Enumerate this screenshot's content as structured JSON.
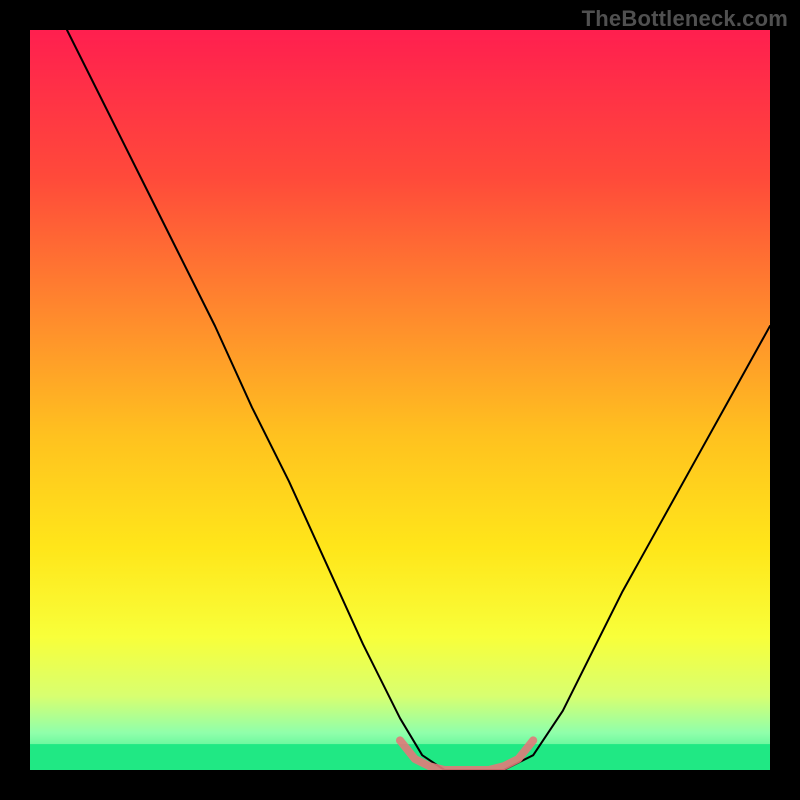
{
  "watermark": "TheBottleneck.com",
  "chart_data": {
    "type": "line",
    "title": "",
    "xlabel": "",
    "ylabel": "",
    "xlim": [
      0,
      100
    ],
    "ylim": [
      0,
      100
    ],
    "background_gradient_stops": [
      {
        "offset": 0.0,
        "color": "#ff1f4f"
      },
      {
        "offset": 0.2,
        "color": "#ff4a3a"
      },
      {
        "offset": 0.4,
        "color": "#ff8f2c"
      },
      {
        "offset": 0.55,
        "color": "#ffc21f"
      },
      {
        "offset": 0.7,
        "color": "#ffe61a"
      },
      {
        "offset": 0.82,
        "color": "#f8ff3a"
      },
      {
        "offset": 0.9,
        "color": "#d8ff70"
      },
      {
        "offset": 0.95,
        "color": "#8fffab"
      },
      {
        "offset": 1.0,
        "color": "#20e884"
      }
    ],
    "bottom_band": {
      "y_from": 96.5,
      "y_to": 100,
      "color": "#20e884"
    },
    "series": [
      {
        "name": "bottleneck-curve",
        "color": "#000000",
        "width": 2,
        "x": [
          5,
          10,
          15,
          20,
          25,
          30,
          35,
          40,
          45,
          50,
          53,
          56,
          60,
          64,
          68,
          72,
          76,
          80,
          85,
          90,
          95,
          100
        ],
        "y": [
          100,
          90,
          80,
          70,
          60,
          49,
          39,
          28,
          17,
          7,
          2,
          0,
          0,
          0,
          2,
          8,
          16,
          24,
          33,
          42,
          51,
          60
        ]
      },
      {
        "name": "valley-highlight",
        "color": "#e17a7a",
        "width": 8,
        "linecap": "round",
        "x": [
          50,
          52,
          54,
          56,
          58,
          60,
          62,
          64,
          66,
          68
        ],
        "y": [
          4,
          1.5,
          0.5,
          0,
          0,
          0,
          0,
          0.5,
          1.5,
          4
        ]
      }
    ],
    "annotations": []
  }
}
